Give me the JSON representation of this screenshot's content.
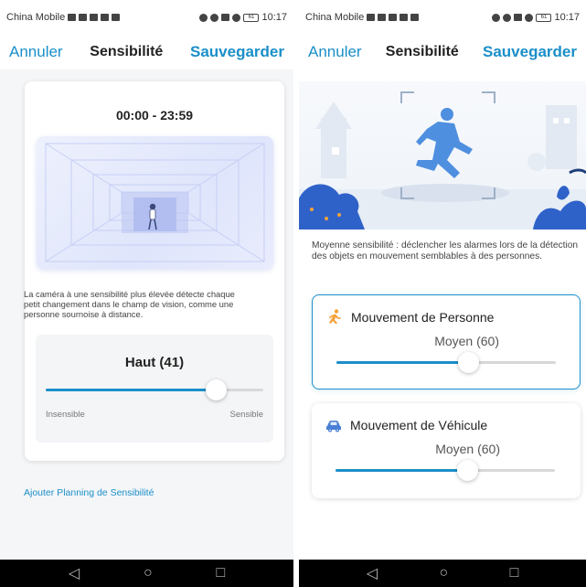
{
  "status": {
    "carrier": "China Mobile",
    "time": "10:17",
    "battery": "61"
  },
  "left": {
    "nav": {
      "cancel": "Annuler",
      "title": "Sensibilité",
      "save": "Sauvegarder"
    },
    "time_range": "00:00 - 23:59",
    "description": "La caméra à une sensibilité plus élevée détecte chaque petit changement dans le champ de vision, comme une personne sournoise à distance.",
    "sensitivity": {
      "label": "Haut (41)",
      "level": 0.78,
      "min_label": "Insensible",
      "max_label": "Sensible"
    },
    "add_schedule": "Ajouter Planning de Sensibilité"
  },
  "right": {
    "nav": {
      "cancel": "Annuler",
      "title": "Sensibilité",
      "save": "Sauvegarder"
    },
    "description": "Moyenne sensibilité : déclencher les alarmes lors de la détection des objets en mouvement semblables à des personnes.",
    "cards": [
      {
        "title": "Mouvement de Personne",
        "value": "Moyen (60)",
        "level": 0.6,
        "icon": "running-person-icon",
        "selected": true
      },
      {
        "title": "Mouvement de Véhicule",
        "value": "Moyen (60)",
        "level": 0.6,
        "icon": "car-icon",
        "selected": false
      }
    ]
  },
  "system_nav": {
    "back": "◁",
    "home": "○",
    "recents": "□"
  },
  "colors": {
    "accent": "#1a8fc9",
    "person_icon": "#f5a23a",
    "vehicle_icon": "#4a7fd6"
  }
}
